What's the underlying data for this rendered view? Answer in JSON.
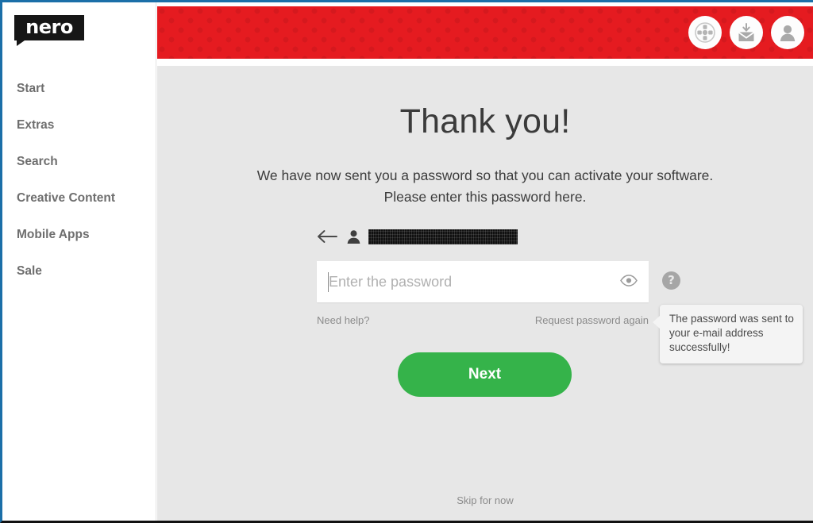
{
  "window": {
    "border_color": "#1b6fa8",
    "bottom_border_color": "#111111"
  },
  "sidebar": {
    "logo_text": "nero",
    "items": [
      {
        "label": "Start"
      },
      {
        "label": "Extras"
      },
      {
        "label": "Search"
      },
      {
        "label": "Creative Content"
      },
      {
        "label": "Mobile Apps"
      },
      {
        "label": "Sale"
      }
    ]
  },
  "header": {
    "background_color": "#e51b20",
    "icons": [
      {
        "name": "navigate-icon"
      },
      {
        "name": "download-mail-icon"
      },
      {
        "name": "user-account-icon"
      }
    ]
  },
  "main": {
    "title": "Thank you!",
    "subtitle": "We have now sent you a password so that you can activate your software. Please enter this password here.",
    "account": {
      "back_arrow": "←",
      "email": "",
      "email_redacted": true
    },
    "password": {
      "value": "",
      "placeholder": "Enter the password",
      "reveal_icon": "eye-icon",
      "help_icon_label": "?"
    },
    "links": {
      "need_help": "Need help?",
      "request_password_again": "Request password again",
      "skip_for_now": "Skip for now"
    },
    "tooltip": {
      "text": "The password was sent to your e-mail address successfully!"
    },
    "primary_button": {
      "label": "Next",
      "color": "#35b34a"
    }
  }
}
